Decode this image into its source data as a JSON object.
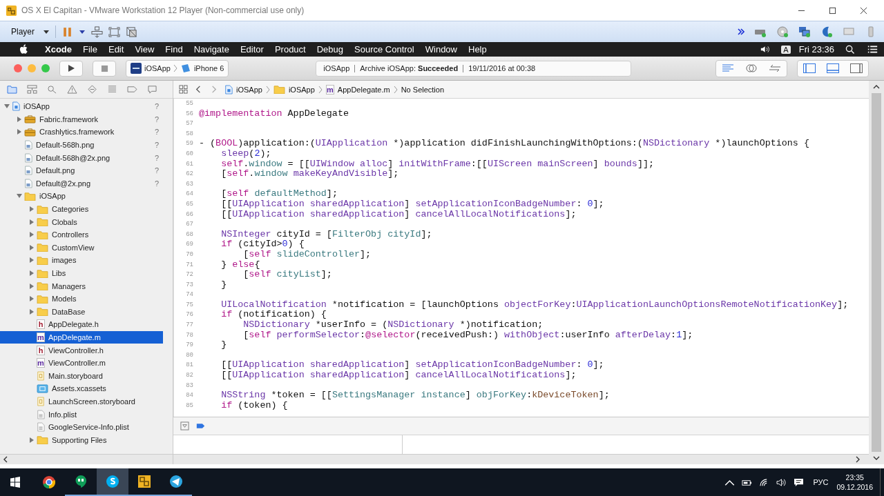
{
  "vm_window": {
    "title": "OS X El Capitan - VMware Workstation 12 Player (Non-commercial use only)"
  },
  "vm_toolbar": {
    "player_menu": "Player",
    "paused": true,
    "devices": [
      {
        "kind": "disk",
        "connected": true
      },
      {
        "kind": "cd",
        "connected": true
      },
      {
        "kind": "network",
        "connected": true
      },
      {
        "kind": "sound",
        "connected": true
      },
      {
        "kind": "display",
        "connected": false
      },
      {
        "kind": "usb",
        "connected": false
      }
    ]
  },
  "menu_bar": {
    "menus": [
      {
        "label": "Xcode",
        "kind": "app"
      },
      {
        "label": "File",
        "kind": "menu"
      },
      {
        "label": "Edit",
        "kind": "menu"
      },
      {
        "label": "View",
        "kind": "menu"
      },
      {
        "label": "Find",
        "kind": "menu"
      },
      {
        "label": "Navigate",
        "kind": "menu"
      },
      {
        "label": "Editor",
        "kind": "menu"
      },
      {
        "label": "Product",
        "kind": "menu"
      },
      {
        "label": "Debug",
        "kind": "menu"
      },
      {
        "label": "Source Control",
        "kind": "menu"
      },
      {
        "label": "Window",
        "kind": "menu"
      },
      {
        "label": "Help",
        "kind": "menu"
      }
    ],
    "input_source": "A",
    "clock": "Fri 23:36"
  },
  "toolbar": {
    "scheme": "iOSApp",
    "device": "iPhone 6",
    "activity": [
      "iOSApp",
      "Archive iOSApp: **Succeeded**",
      "19/11/2016 at 00:38"
    ],
    "editor_modes": [
      {
        "kind": "standard",
        "selected": true
      },
      {
        "kind": "assistant",
        "selected": false
      },
      {
        "kind": "version",
        "selected": false
      }
    ],
    "panels": [
      {
        "kind": "navigator",
        "on": true
      },
      {
        "kind": "debug",
        "on": true
      },
      {
        "kind": "utilities",
        "on": false
      }
    ]
  },
  "navigator_tabs": [
    {
      "kind": "project",
      "selected": true
    },
    {
      "kind": "symbol",
      "selected": false
    },
    {
      "kind": "find",
      "selected": false
    },
    {
      "kind": "issue",
      "selected": false
    },
    {
      "kind": "test",
      "selected": false
    },
    {
      "kind": "debug",
      "selected": false
    },
    {
      "kind": "breakpoint",
      "selected": false
    },
    {
      "kind": "report",
      "selected": false
    }
  ],
  "jump_bar": [
    {
      "label": "iOSApp",
      "kind": "project"
    },
    {
      "label": "iOSApp",
      "kind": "folder"
    },
    {
      "label": "AppDelegate.m",
      "kind": "source",
      "badge": "m"
    },
    {
      "label": "No Selection",
      "kind": "none"
    }
  ],
  "project_tree": [
    {
      "name": "iOSApp",
      "kind": "project",
      "expanded": true,
      "status": "?",
      "selected": false,
      "children": [
        {
          "name": "Fabric.framework",
          "kind": "framework",
          "expanded": false,
          "status": "?",
          "selected": false
        },
        {
          "name": "Crashlytics.framework",
          "kind": "framework",
          "expanded": false,
          "status": "?",
          "selected": false
        },
        {
          "name": "Default-568h.png",
          "kind": "image",
          "status": "?",
          "selected": false
        },
        {
          "name": "Default-568h@2x.png",
          "kind": "image",
          "status": "?",
          "selected": false
        },
        {
          "name": "Default.png",
          "kind": "image",
          "status": "?",
          "selected": false
        },
        {
          "name": "Default@2x.png",
          "kind": "image",
          "status": "?",
          "selected": false
        },
        {
          "name": "iOSApp",
          "kind": "folder",
          "expanded": true,
          "selected": false,
          "children": [
            {
              "name": "Categories",
              "kind": "folder",
              "expanded": false,
              "selected": false
            },
            {
              "name": "Clobals",
              "kind": "folder",
              "expanded": false,
              "selected": false
            },
            {
              "name": "Controllers",
              "kind": "folder",
              "expanded": false,
              "selected": false
            },
            {
              "name": "CustomView",
              "kind": "folder",
              "expanded": false,
              "selected": false
            },
            {
              "name": "images",
              "kind": "folder",
              "expanded": false,
              "selected": false
            },
            {
              "name": "Libs",
              "kind": "folder",
              "expanded": false,
              "selected": false
            },
            {
              "name": "Managers",
              "kind": "folder",
              "expanded": false,
              "selected": false
            },
            {
              "name": "Models",
              "kind": "folder",
              "expanded": false,
              "selected": false
            },
            {
              "name": "DataBase",
              "kind": "folder",
              "expanded": false,
              "selected": false
            },
            {
              "name": "AppDelegate.h",
              "kind": "header",
              "badge": "h",
              "selected": false
            },
            {
              "name": "AppDelegate.m",
              "kind": "source",
              "badge": "m",
              "selected": true
            },
            {
              "name": "ViewController.h",
              "kind": "header",
              "badge": "h",
              "selected": false
            },
            {
              "name": "ViewController.m",
              "kind": "source",
              "badge": "m",
              "selected": false
            },
            {
              "name": "Main.storyboard",
              "kind": "storyboard",
              "selected": false
            },
            {
              "name": "Assets.xcassets",
              "kind": "assets",
              "selected": false
            },
            {
              "name": "LaunchScreen.storyboard",
              "kind": "storyboard",
              "selected": false
            },
            {
              "name": "Info.plist",
              "kind": "plist",
              "selected": false
            },
            {
              "name": "GoogleService-Info.plist",
              "kind": "plist",
              "selected": false
            },
            {
              "name": "Supporting Files",
              "kind": "folder",
              "expanded": false,
              "selected": false
            }
          ]
        }
      ]
    }
  ],
  "code_lines": [
    {
      "number": "55"
    },
    {
      "number": "56",
      "tokens": [
        {
          "kind": "keyword",
          "text": "@implementation"
        },
        {
          "kind": "plain",
          "text": " AppDelegate"
        }
      ]
    },
    {
      "number": "57"
    },
    {
      "number": "58"
    },
    {
      "number": "59",
      "tokens": [
        {
          "kind": "plain",
          "text": "- ("
        },
        {
          "kind": "keyword",
          "text": "BOOL"
        },
        {
          "kind": "plain",
          "text": ")application:("
        },
        {
          "kind": "system",
          "text": "UIApplication"
        },
        {
          "kind": "plain",
          "text": " *)application didFinishLaunchingWithOptions:("
        },
        {
          "kind": "system",
          "text": "NSDictionary"
        },
        {
          "kind": "plain",
          "text": " *)launchOptions {"
        }
      ]
    },
    {
      "number": "60",
      "tokens": [
        {
          "kind": "system",
          "text": "    sleep"
        },
        {
          "kind": "plain",
          "text": "("
        },
        {
          "kind": "number",
          "text": "2"
        },
        {
          "kind": "plain",
          "text": ");"
        }
      ]
    },
    {
      "number": "61",
      "tokens": [
        {
          "kind": "keyword",
          "text": "    self"
        },
        {
          "kind": "plain",
          "text": "."
        },
        {
          "kind": "user",
          "text": "window"
        },
        {
          "kind": "plain",
          "text": " = [["
        },
        {
          "kind": "system",
          "text": "UIWindow alloc"
        },
        {
          "kind": "plain",
          "text": "] "
        },
        {
          "kind": "system",
          "text": "initWithFrame"
        },
        {
          "kind": "plain",
          "text": ":[["
        },
        {
          "kind": "system",
          "text": "UIScreen mainScreen"
        },
        {
          "kind": "plain",
          "text": "] "
        },
        {
          "kind": "system",
          "text": "bounds"
        },
        {
          "kind": "plain",
          "text": "]];"
        }
      ]
    },
    {
      "number": "62",
      "tokens": [
        {
          "kind": "plain",
          "text": "    ["
        },
        {
          "kind": "keyword",
          "text": "self"
        },
        {
          "kind": "plain",
          "text": "."
        },
        {
          "kind": "user",
          "text": "window"
        },
        {
          "kind": "system",
          "text": " makeKeyAndVisible"
        },
        {
          "kind": "plain",
          "text": "];"
        }
      ]
    },
    {
      "number": "63"
    },
    {
      "number": "64",
      "tokens": [
        {
          "kind": "plain",
          "text": "    ["
        },
        {
          "kind": "keyword",
          "text": "self"
        },
        {
          "kind": "user",
          "text": " defaultMethod"
        },
        {
          "kind": "plain",
          "text": "];"
        }
      ]
    },
    {
      "number": "65",
      "tokens": [
        {
          "kind": "plain",
          "text": "    [["
        },
        {
          "kind": "system",
          "text": "UIApplication sharedApplication"
        },
        {
          "kind": "plain",
          "text": "] "
        },
        {
          "kind": "system",
          "text": "setApplicationIconBadgeNumber"
        },
        {
          "kind": "plain",
          "text": ": "
        },
        {
          "kind": "number",
          "text": "0"
        },
        {
          "kind": "plain",
          "text": "];"
        }
      ]
    },
    {
      "number": "66",
      "tokens": [
        {
          "kind": "plain",
          "text": "    [["
        },
        {
          "kind": "system",
          "text": "UIApplication sharedApplication"
        },
        {
          "kind": "plain",
          "text": "] "
        },
        {
          "kind": "system",
          "text": "cancelAllLocalNotifications"
        },
        {
          "kind": "plain",
          "text": "];"
        }
      ]
    },
    {
      "number": "67"
    },
    {
      "number": "68",
      "tokens": [
        {
          "kind": "system",
          "text": "    NSInteger"
        },
        {
          "kind": "plain",
          "text": " cityId = ["
        },
        {
          "kind": "user",
          "text": "FilterObj cityId"
        },
        {
          "kind": "plain",
          "text": "];"
        }
      ]
    },
    {
      "number": "69",
      "tokens": [
        {
          "kind": "keyword",
          "text": "    if"
        },
        {
          "kind": "plain",
          "text": " (cityId>"
        },
        {
          "kind": "number",
          "text": "0"
        },
        {
          "kind": "plain",
          "text": ") {"
        }
      ]
    },
    {
      "number": "70",
      "tokens": [
        {
          "kind": "plain",
          "text": "        ["
        },
        {
          "kind": "keyword",
          "text": "self"
        },
        {
          "kind": "user",
          "text": " slideController"
        },
        {
          "kind": "plain",
          "text": "];"
        }
      ]
    },
    {
      "number": "71",
      "tokens": [
        {
          "kind": "plain",
          "text": "    } "
        },
        {
          "kind": "keyword",
          "text": "else"
        },
        {
          "kind": "plain",
          "text": "{"
        }
      ]
    },
    {
      "number": "72",
      "tokens": [
        {
          "kind": "plain",
          "text": "        ["
        },
        {
          "kind": "keyword",
          "text": "self"
        },
        {
          "kind": "user",
          "text": " cityList"
        },
        {
          "kind": "plain",
          "text": "];"
        }
      ]
    },
    {
      "number": "73",
      "tokens": [
        {
          "kind": "plain",
          "text": "    }"
        }
      ]
    },
    {
      "number": "74"
    },
    {
      "number": "75",
      "tokens": [
        {
          "kind": "system",
          "text": "    UILocalNotification"
        },
        {
          "kind": "plain",
          "text": " *notification = [launchOptions "
        },
        {
          "kind": "system",
          "text": "objectForKey"
        },
        {
          "kind": "plain",
          "text": ":"
        },
        {
          "kind": "system",
          "text": "UIApplicationLaunchOptionsRemoteNotificationKey"
        },
        {
          "kind": "plain",
          "text": "];"
        }
      ]
    },
    {
      "number": "76",
      "tokens": [
        {
          "kind": "keyword",
          "text": "    if"
        },
        {
          "kind": "plain",
          "text": " (notification) {"
        }
      ]
    },
    {
      "number": "77",
      "tokens": [
        {
          "kind": "system",
          "text": "        NSDictionary"
        },
        {
          "kind": "plain",
          "text": " *userInfo = ("
        },
        {
          "kind": "system",
          "text": "NSDictionary"
        },
        {
          "kind": "plain",
          "text": " *)notification;"
        }
      ]
    },
    {
      "number": "78",
      "tokens": [
        {
          "kind": "plain",
          "text": "        ["
        },
        {
          "kind": "keyword",
          "text": "self"
        },
        {
          "kind": "system",
          "text": " performSelector"
        },
        {
          "kind": "plain",
          "text": ":"
        },
        {
          "kind": "keyword",
          "text": "@selector"
        },
        {
          "kind": "plain",
          "text": "(receivedPush:) "
        },
        {
          "kind": "system",
          "text": "withObject"
        },
        {
          "kind": "plain",
          "text": ":userInfo "
        },
        {
          "kind": "system",
          "text": "afterDelay"
        },
        {
          "kind": "plain",
          "text": ":"
        },
        {
          "kind": "number",
          "text": "1"
        },
        {
          "kind": "plain",
          "text": "];"
        }
      ]
    },
    {
      "number": "79",
      "tokens": [
        {
          "kind": "plain",
          "text": "    }"
        }
      ]
    },
    {
      "number": "80"
    },
    {
      "number": "81",
      "tokens": [
        {
          "kind": "plain",
          "text": "    [["
        },
        {
          "kind": "system",
          "text": "UIApplication sharedApplication"
        },
        {
          "kind": "plain",
          "text": "] "
        },
        {
          "kind": "system",
          "text": "setApplicationIconBadgeNumber"
        },
        {
          "kind": "plain",
          "text": ": "
        },
        {
          "kind": "number",
          "text": "0"
        },
        {
          "kind": "plain",
          "text": "];"
        }
      ]
    },
    {
      "number": "82",
      "tokens": [
        {
          "kind": "plain",
          "text": "    [["
        },
        {
          "kind": "system",
          "text": "UIApplication sharedApplication"
        },
        {
          "kind": "plain",
          "text": "] "
        },
        {
          "kind": "system",
          "text": "cancelAllLocalNotifications"
        },
        {
          "kind": "plain",
          "text": "];"
        }
      ]
    },
    {
      "number": "83"
    },
    {
      "number": "84",
      "tokens": [
        {
          "kind": "system",
          "text": "    NSString"
        },
        {
          "kind": "plain",
          "text": " *token = [["
        },
        {
          "kind": "user",
          "text": "SettingsManager instance"
        },
        {
          "kind": "plain",
          "text": "] "
        },
        {
          "kind": "user",
          "text": "objForKey"
        },
        {
          "kind": "plain",
          "text": ":"
        },
        {
          "kind": "constant",
          "text": "kDeviceToken"
        },
        {
          "kind": "plain",
          "text": "];"
        }
      ]
    },
    {
      "number": "85",
      "tokens": [
        {
          "kind": "keyword",
          "text": "    if"
        },
        {
          "kind": "plain",
          "text": " (token) {"
        }
      ]
    }
  ],
  "taskbar": {
    "apps": [
      {
        "kind": "chrome",
        "running": false,
        "highlighted": false
      },
      {
        "kind": "hangouts",
        "running": true,
        "highlighted": false
      },
      {
        "kind": "skype",
        "running": true,
        "highlighted": true
      },
      {
        "kind": "vmware",
        "running": true,
        "highlighted": false
      },
      {
        "kind": "telegram",
        "running": true,
        "highlighted": false
      }
    ],
    "language": "РУС",
    "time": "23:35",
    "date": "09.12.2016"
  }
}
